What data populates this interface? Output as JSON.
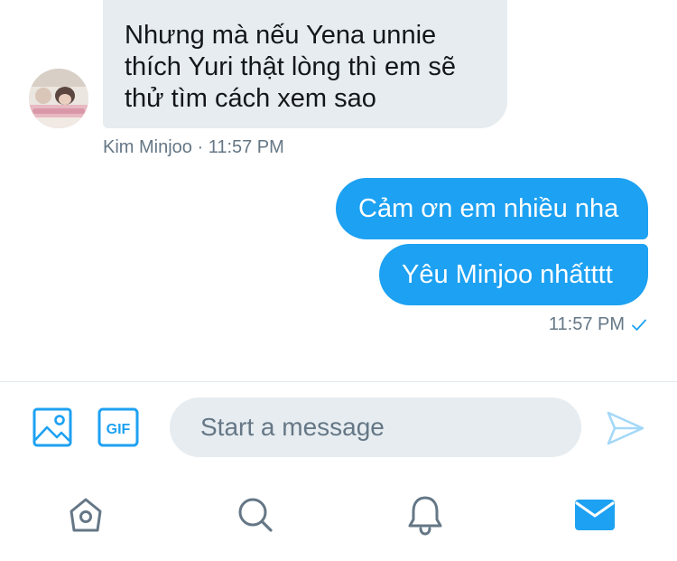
{
  "conversation": {
    "incoming": {
      "text": "Nhưng mà nếu Yena unnie thích Yuri thật lòng thì em sẽ thử tìm cách xem sao",
      "meta": "Kim Minjoo · 11:57 PM"
    },
    "outgoing": [
      {
        "text": "Cảm ơn em nhiều nha"
      },
      {
        "text": "Yêu Minjoo nhấtttt"
      }
    ],
    "outgoing_meta": {
      "time": "11:57 PM",
      "status_icon": "check-icon"
    }
  },
  "composer": {
    "placeholder": "Start a message",
    "media_icon": "image-icon",
    "gif_label": "GIF",
    "send_icon": "send-icon"
  },
  "tabbar": {
    "items": [
      {
        "icon": "home-icon",
        "active": false
      },
      {
        "icon": "search-icon",
        "active": false
      },
      {
        "icon": "bell-icon",
        "active": false
      },
      {
        "icon": "mail-icon",
        "active": true
      }
    ]
  },
  "colors": {
    "accent": "#1da1f2",
    "bubble_incoming": "#e6ecf0",
    "text_secondary": "#657786",
    "icon_inactive": "#657786"
  }
}
